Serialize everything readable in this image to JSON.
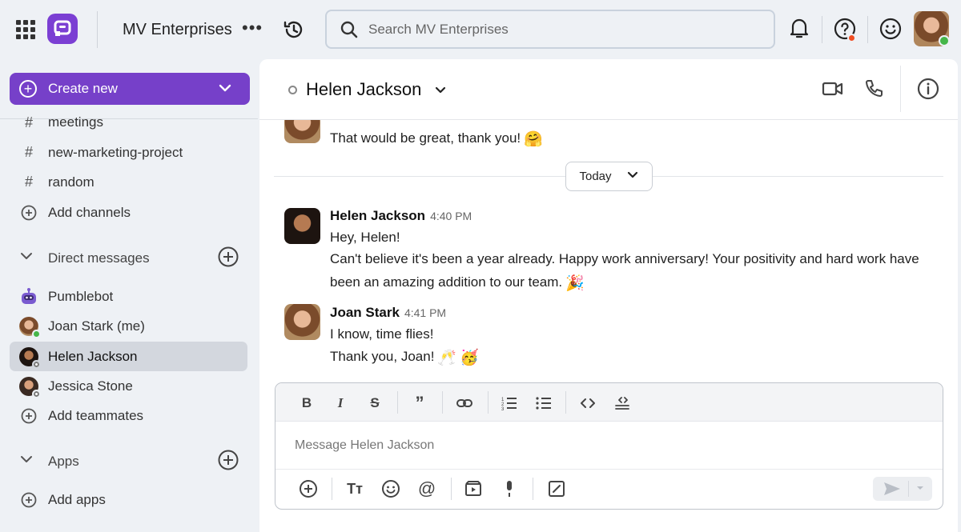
{
  "topbar": {
    "workspace_name": "MV Enterprises",
    "search_placeholder": "Search MV Enterprises",
    "icons": [
      "apps-grid-icon",
      "app-logo-icon",
      "more-icon",
      "history-icon",
      "search-icon",
      "bell-icon",
      "help-icon",
      "emoji-icon"
    ],
    "status_dot_color": "#f04e23"
  },
  "sidebar": {
    "create_label": "Create new",
    "channels": [
      {
        "label": "meetings"
      },
      {
        "label": "new-marketing-project"
      },
      {
        "label": "random"
      }
    ],
    "add_channels_label": "Add channels",
    "dm_section_label": "Direct messages",
    "dms": [
      {
        "label": "Pumblebot"
      },
      {
        "label": "Joan Stark (me)"
      },
      {
        "label": "Helen Jackson"
      },
      {
        "label": "Jessica Stone"
      }
    ],
    "add_teammates_label": "Add teammates",
    "apps_section_label": "Apps",
    "add_apps_label": "Add apps",
    "accent_color": "#7640c9"
  },
  "conversation": {
    "title": "Helen Jackson",
    "prev_message": "That would be great, thank you!",
    "day_divider": "Today",
    "messages": [
      {
        "author": "Helen Jackson",
        "time": "4:40 PM",
        "lines": [
          "Hey, Helen!",
          "Can't believe it's been a year already. Happy work anniversary! Your positivity and hard work have",
          "been an amazing addition to our team."
        ]
      },
      {
        "author": "Joan Stark",
        "time": "4:41 PM",
        "lines": [
          "I know, time flies!",
          "Thank you, Joan!"
        ]
      }
    ]
  },
  "composer": {
    "placeholder": "Message Helen Jackson"
  }
}
